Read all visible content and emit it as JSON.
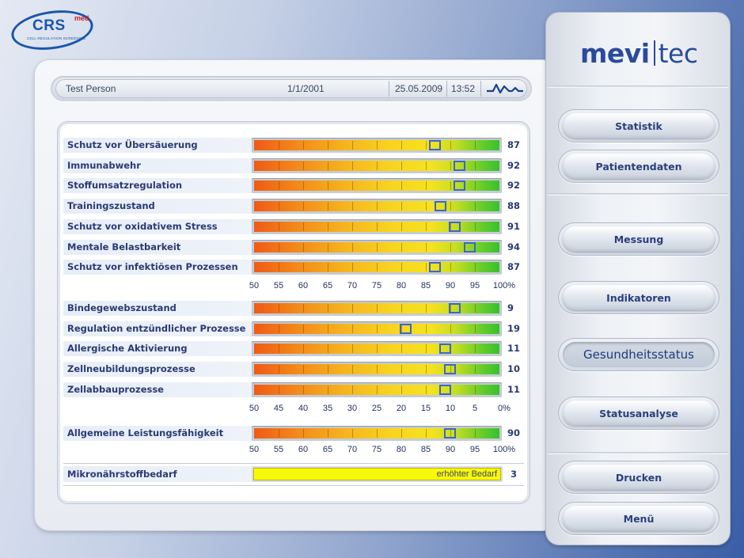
{
  "logo": {
    "text": "CRS",
    "sup": "med",
    "tagline": "CELL REGULATION SCREENING"
  },
  "header": {
    "patient": "Test Person",
    "dob": "1/1/2001",
    "date": "25.05.2009",
    "time": "13:52"
  },
  "brand": {
    "left": "mevi",
    "right": "tec"
  },
  "section1": {
    "scale": [
      "50",
      "55",
      "60",
      "65",
      "70",
      "75",
      "80",
      "85",
      "90",
      "95",
      "100%"
    ],
    "rows": [
      {
        "label": "Schutz vor Übersäuerung",
        "value": "87",
        "marker": 87
      },
      {
        "label": "Immunabwehr",
        "value": "92",
        "marker": 92
      },
      {
        "label": "Stoffumsatzregulation",
        "value": "92",
        "marker": 92
      },
      {
        "label": "Trainingszustand",
        "value": "88",
        "marker": 88
      },
      {
        "label": "Schutz vor oxidativem Stress",
        "value": "91",
        "marker": 91
      },
      {
        "label": "Mentale Belastbarkeit",
        "value": "94",
        "marker": 94
      },
      {
        "label": "Schutz vor infektiösen Prozessen",
        "value": "87",
        "marker": 87
      }
    ]
  },
  "section2": {
    "scale": [
      "50",
      "45",
      "40",
      "35",
      "30",
      "25",
      "20",
      "15",
      "10",
      "5",
      "0%"
    ],
    "rows": [
      {
        "label": "Bindegewebszustand",
        "value": "9",
        "marker": 9
      },
      {
        "label": "Regulation entzündlicher Prozesse",
        "value": "19",
        "marker": 19
      },
      {
        "label": "Allergische Aktivierung",
        "value": "11",
        "marker": 11
      },
      {
        "label": "Zellneubildungsprozesse",
        "value": "10",
        "marker": 10
      },
      {
        "label": "Zellabbauprozesse",
        "value": "11",
        "marker": 11
      }
    ]
  },
  "section3": {
    "scale": [
      "50",
      "55",
      "60",
      "65",
      "70",
      "75",
      "80",
      "85",
      "90",
      "95",
      "100%"
    ],
    "rows": [
      {
        "label": "Allgemeine Leistungsfähigkeit",
        "value": "90",
        "marker": 90
      }
    ]
  },
  "need": {
    "label": "Mikronährstoffbedarf",
    "bar_text": "erhöhter Bedarf",
    "value": "3"
  },
  "nav": [
    {
      "label": "Statistik",
      "active": false
    },
    {
      "label": "Patientendaten",
      "active": false
    },
    {
      "label": "Messung",
      "active": false
    },
    {
      "label": "Indikatoren",
      "active": false
    },
    {
      "label": "Gesundheitsstatus",
      "active": true
    },
    {
      "label": "Statusanalyse",
      "active": false
    },
    {
      "label": "Drucken",
      "active": false
    },
    {
      "label": "Menü",
      "active": false
    }
  ]
}
